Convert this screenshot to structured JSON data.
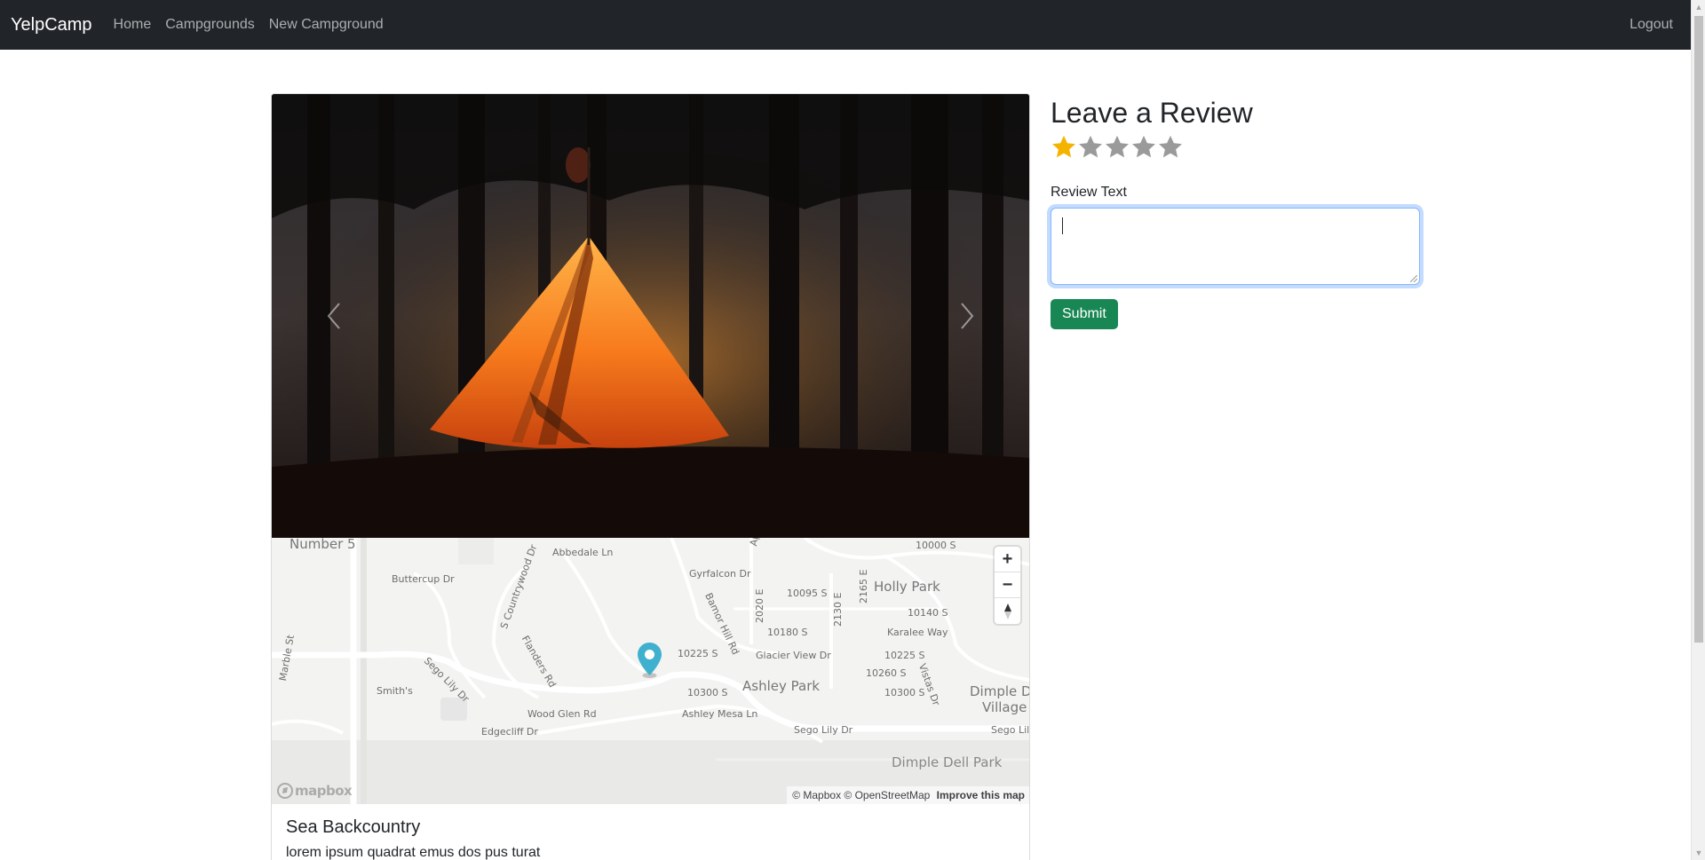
{
  "navbar": {
    "brand": "YelpCamp",
    "links": [
      "Home",
      "Campgrounds",
      "New Campground"
    ],
    "logout": "Logout"
  },
  "carousel": {
    "prev_icon": "chevron-left-icon",
    "next_icon": "chevron-right-icon"
  },
  "map": {
    "labels": [
      "Number 5",
      "Abbedale Ln",
      "Gyrfalcon Dr",
      "Aplora",
      "10000 S",
      "Buttercup Dr",
      "S Countrywood Dr",
      "Bamor Hill Rd",
      "2020 E",
      "10095 S",
      "2130 E",
      "2165 E",
      "Holly Park",
      "10140 S",
      "10180 S",
      "Karalee Way",
      "Marble St",
      "Flanders Rd",
      "Sego Lily Dr",
      "10225 S",
      "Glacier View Dr",
      "10225 S",
      "Vistas Dr",
      "10260 S",
      "Smith's",
      "Ashley Park",
      "10300 S",
      "10300 S",
      "Dimple Dell",
      "Village",
      "Wood Glen Rd",
      "Ashley Mesa Ln",
      "Edgecliff Dr",
      "Sego Lily Dr",
      "Sego Lily",
      "Dimple Dell Park"
    ],
    "zoom_in": "+",
    "zoom_out": "−",
    "logo": "mapbox",
    "attribution": "© Mapbox © OpenStreetMap",
    "improve": "Improve this map"
  },
  "campground": {
    "title": "Sea Backcountry",
    "description": "lorem ipsum quadrat emus dos pus turat"
  },
  "review": {
    "heading": "Leave a Review",
    "rating": 1,
    "max_rating": 5,
    "star_color_active": "#f5b301",
    "star_color_inactive": "#9a9a9a",
    "text_label": "Review Text",
    "text_value": "",
    "submit_label": "Submit"
  },
  "colors": {
    "navbar": "#212529",
    "submit": "#198754",
    "focus": "#86b7fe",
    "marker": "#3fb1ce"
  }
}
